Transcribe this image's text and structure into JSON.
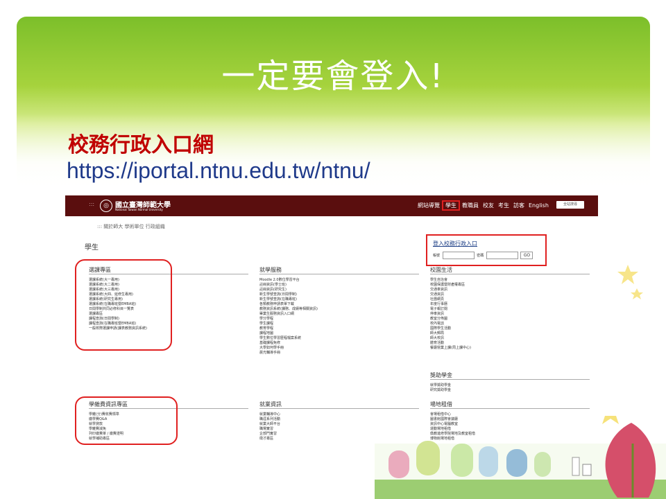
{
  "slide": {
    "title": "一定要會登入!",
    "subtitle": "校務行政入口網",
    "url": "https://iportal.ntnu.edu.tw/ntnu/"
  },
  "portal": {
    "dots": ":::",
    "logo_text": "國立臺灣師範大學",
    "logo_sub": "National Taiwan Normal University",
    "nav": [
      "網站導覽",
      "學生",
      "教職員",
      "校友",
      "考生",
      "訪客",
      "English"
    ],
    "active_nav_index": 1,
    "search_label": "全站搜尋",
    "breadcrumbs": ":::   關於師大   學術單位   行政組織",
    "page_heading": "學生",
    "login": {
      "link": "登入校務行政入口",
      "account_label": "帳號",
      "password_label": "密碼",
      "go": "GO"
    },
    "sections": [
      {
        "heading": "選課專區",
        "items": [
          "選課系統(大一專用)",
          "選課系統(大二專用)",
          "選課系統(大三專用)",
          "選課系統(大四、延修生專用)",
          "選課系統(研究生專用)",
          "選課系統(在職專班暨EMBA班)",
          "日間學制共同必修科目一覽表",
          "選課專區",
          "課程查詢(日間學制)",
          "課程查詢(在職專班暨EMBA班)",
          "一般校際選課申請(課表教務資訊系統)"
        ]
      },
      {
        "heading": "就學服務",
        "items": [
          "Moodle 2.0數位學習平台",
          "註冊資訊(學士班)",
          "註冊資訊(研究生)",
          "新生學號查詢(日間學制)",
          "新生學號查詢(在職專班)",
          "各類教務申請表單下載",
          "教務資訊系統(課務、成績等相關資訊)",
          "畢業生服務資訊入口網",
          "學分學程",
          "學生課程",
          "教育學程",
          "課程地圖",
          "學生數位學習歷程檔案系統",
          "基礎課程免修",
          "大學如何學手冊",
          "晨光輔導手冊"
        ]
      },
      {
        "heading": "校園生活",
        "items": [
          "學生自治會",
          "校園保護暨財產權專區",
          "交通車資訊",
          "交通資訊",
          "社團網頁",
          "年度行事曆",
          "電子報訂閱",
          "停車資訊",
          "教室分佈圖",
          "校內電話",
          "國際學生活動",
          "師大郵局",
          "師大校訊",
          "體育活動",
          "餐廳營業上課(周上課中心)"
        ]
      },
      {
        "heading": "獎助學金",
        "items": [
          "就學獎助學金",
          "研究獎助學金"
        ]
      },
      {
        "heading": "學雜費資訊專區",
        "items": [
          "學雜(分)費收費標準",
          "繳學費Q&A",
          "就學貸款",
          "學雜費減免",
          "列印繳費單 / 繳費證明",
          "就學補助專區"
        ]
      },
      {
        "heading": "就業資訊",
        "items": [
          "就業輔導中心",
          "職涯系列活動",
          "就業大師平台",
          "職場實習",
          "企部門實習",
          "徵才專區"
        ]
      },
      {
        "heading": "場地租借",
        "items": [
          "會場租借中心",
          "圖書館國際會議廳",
          "資訊中心電腦教室",
          "運動場地租借",
          "僑教進修學院場地及教室租借",
          "博物館場地租借"
        ]
      }
    ]
  }
}
